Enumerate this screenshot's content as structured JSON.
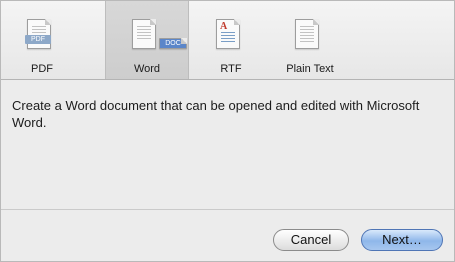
{
  "formats": [
    {
      "label": "PDF",
      "icon": "pdf-file-icon",
      "tag": "PDF"
    },
    {
      "label": "Word",
      "icon": "word-doc-file-icon",
      "tag": "DOC",
      "selected": true
    },
    {
      "label": "RTF",
      "icon": "rtf-file-icon"
    },
    {
      "label": "Plain Text",
      "icon": "plain-text-file-icon"
    }
  ],
  "description": "Create a Word document that can be opened and edited with Microsoft Word.",
  "buttons": {
    "cancel": "Cancel",
    "next": "Next…"
  },
  "colors": {
    "accent": "#8fb7ea",
    "selected_tab": "#cdcdcd"
  }
}
